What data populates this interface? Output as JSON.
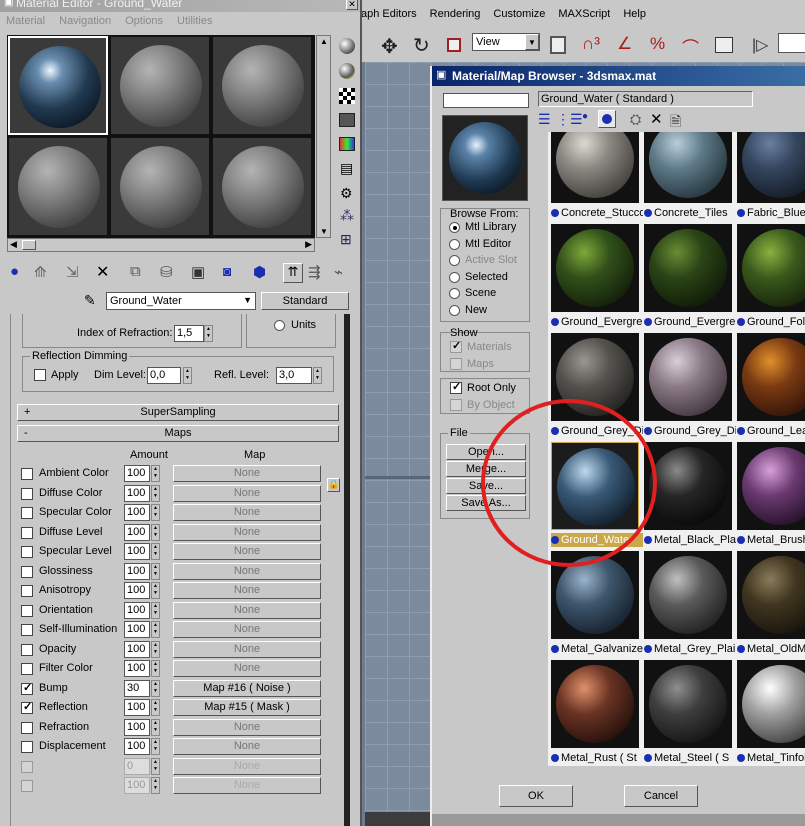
{
  "viewport_bg": "#6c7b8e",
  "me": {
    "title": "Material Editor - Ground_Water",
    "menu": [
      "Material",
      "Navigation",
      "Options",
      "Utilities"
    ],
    "material_name": "Ground_Water",
    "type_button": "Standard",
    "ior_label": "Index of Refraction:",
    "ior_value": "1,5",
    "units_label": "Units",
    "reflection_dimming": "Reflection Dimming",
    "apply": "Apply",
    "dim_level_label": "Dim Level:",
    "dim_level_value": "0,0",
    "refl_level_label": "Refl. Level:",
    "refl_level_value": "3,0",
    "supersampling": "SuperSampling",
    "supersampling_sign": "+",
    "maps_title": "Maps",
    "maps_sign": "-",
    "amount_header": "Amount",
    "map_header": "Map",
    "maps": [
      {
        "name": "Ambient Color",
        "amount": "100",
        "map": "None",
        "checked": false
      },
      {
        "name": "Diffuse Color",
        "amount": "100",
        "map": "None",
        "checked": false
      },
      {
        "name": "Specular Color",
        "amount": "100",
        "map": "None",
        "checked": false
      },
      {
        "name": "Diffuse Level",
        "amount": "100",
        "map": "None",
        "checked": false
      },
      {
        "name": "Specular Level",
        "amount": "100",
        "map": "None",
        "checked": false
      },
      {
        "name": "Glossiness",
        "amount": "100",
        "map": "None",
        "checked": false
      },
      {
        "name": "Anisotropy",
        "amount": "100",
        "map": "None",
        "checked": false
      },
      {
        "name": "Orientation",
        "amount": "100",
        "map": "None",
        "checked": false
      },
      {
        "name": "Self-Illumination",
        "amount": "100",
        "map": "None",
        "checked": false
      },
      {
        "name": "Opacity",
        "amount": "100",
        "map": "None",
        "checked": false
      },
      {
        "name": "Filter Color",
        "amount": "100",
        "map": "None",
        "checked": false
      },
      {
        "name": "Bump",
        "amount": "30",
        "map": "Map #16  ( Noise )",
        "checked": true
      },
      {
        "name": "Reflection",
        "amount": "100",
        "map": "Map #15  ( Mask )",
        "checked": true
      },
      {
        "name": "Refraction",
        "amount": "100",
        "map": "None",
        "checked": false
      },
      {
        "name": "Displacement",
        "amount": "100",
        "map": "None",
        "checked": false
      },
      {
        "name": "",
        "amount": "0",
        "map": "None",
        "checked": false
      },
      {
        "name": "",
        "amount": "100",
        "map": "None",
        "checked": false
      }
    ]
  },
  "main_menu": [
    "aph Editors",
    "Rendering",
    "Customize",
    "MAXScript",
    "Help"
  ],
  "toolbar": {
    "view_dropdown": "View"
  },
  "mb": {
    "title": "Material/Map Browser - 3dsmax.mat",
    "selected_display": "Ground_Water  ( Standard )",
    "browse_from_title": "Browse From:",
    "browse_from": [
      {
        "label": "Mtl Library",
        "selected": true,
        "enabled": true
      },
      {
        "label": "Mtl Editor",
        "selected": false,
        "enabled": true
      },
      {
        "label": "Active Slot",
        "selected": false,
        "enabled": false
      },
      {
        "label": "Selected",
        "selected": false,
        "enabled": true
      },
      {
        "label": "Scene",
        "selected": false,
        "enabled": true
      },
      {
        "label": "New",
        "selected": false,
        "enabled": true
      }
    ],
    "show_title": "Show",
    "show_materials": "Materials",
    "show_maps": "Maps",
    "root_only": "Root Only",
    "by_object": "By Object",
    "file_title": "File",
    "file_buttons": [
      "Open...",
      "Merge...",
      "Save...",
      "Save As..."
    ],
    "ok": "OK",
    "cancel": "Cancel",
    "highlight_color": "#e02020",
    "items": [
      {
        "label": "Concrete_Stucco",
        "c1": "#dcd8d2",
        "c2": "#8a8680",
        "c3": "#3a3835"
      },
      {
        "label": "Concrete_Tiles",
        "c1": "#b9cdd8",
        "c2": "#5e7a88",
        "c3": "#1f2e36"
      },
      {
        "label": "Fabric_Blue_",
        "c1": "#6a7fa0",
        "c2": "#34465e",
        "c3": "#10161f"
      },
      {
        "label": "Ground_Evergre",
        "c1": "#7ea83a",
        "c2": "#31501a",
        "c3": "#0f1a08"
      },
      {
        "label": "Ground_Evergre",
        "c1": "#6a8c34",
        "c2": "#2a4416",
        "c3": "#0d1606"
      },
      {
        "label": "Ground_Folia",
        "c1": "#8ab040",
        "c2": "#3a5a1c",
        "c3": "#121c08"
      },
      {
        "label": "Ground_Grey_Dir",
        "c1": "#9a9690",
        "c2": "#55524e",
        "c3": "#1e1d1b"
      },
      {
        "label": "Ground_Grey_Di",
        "c1": "#d8cfd8",
        "c2": "#8a7a86",
        "c3": "#3a3038"
      },
      {
        "label": "Ground_Lea",
        "c1": "#e0902a",
        "c2": "#7a3a12",
        "c3": "#2a1006"
      },
      {
        "label": "Ground_Water",
        "c1": "#bcd8ee",
        "c2": "#3a5a78",
        "c3": "#0c1824"
      },
      {
        "label": "Metal_Black_Pla",
        "c1": "#8a8a8a",
        "c2": "#262626",
        "c3": "#050505"
      },
      {
        "label": "Metal_Brush",
        "c1": "#d7a0d8",
        "c2": "#6a3a70",
        "c3": "#1e0c22"
      },
      {
        "label": "Metal_Galvanize",
        "c1": "#9ab4cc",
        "c2": "#3e566c",
        "c3": "#101a24"
      },
      {
        "label": "Metal_Grey_Plai",
        "c1": "#c0c0c0",
        "c2": "#5a5a5a",
        "c3": "#1a1a1a"
      },
      {
        "label": "Metal_OldMe",
        "c1": "#8a7a5a",
        "c2": "#403620",
        "c3": "#14100a"
      },
      {
        "label": "Metal_Rust  ( St",
        "c1": "#e0906a",
        "c2": "#6a3424",
        "c3": "#1e0c08"
      },
      {
        "label": "Metal_Steel  ( S",
        "c1": "#8e8e8e",
        "c2": "#3e3e3e",
        "c3": "#101010"
      },
      {
        "label": "Metal_Tinfoil",
        "c1": "#ffffff",
        "c2": "#a0a0a0",
        "c3": "#383838"
      }
    ]
  }
}
